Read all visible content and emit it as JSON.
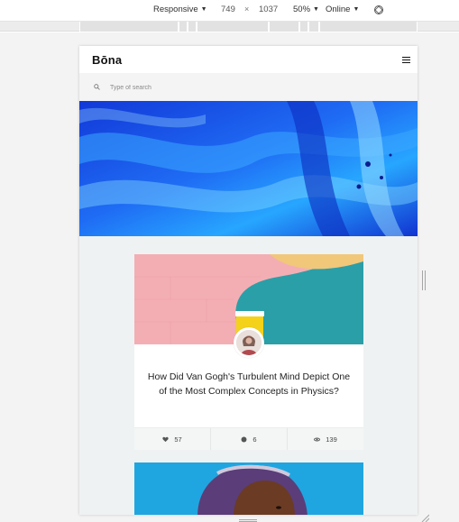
{
  "devtools": {
    "device": "Responsive",
    "width": "749",
    "times": "×",
    "height": "1037",
    "zoom": "50%",
    "network": "Online",
    "rotate_icon": "rotate-icon"
  },
  "site": {
    "logo": "Bōna",
    "menu_icon": "hamburger-menu-icon",
    "search": {
      "placeholder": "Type of search",
      "icon": "search-icon"
    }
  },
  "cards": [
    {
      "title": "How Did Van Gogh's Turbulent Mind Depict One of the Most Complex Concepts in Physics?",
      "likes": "57",
      "comments": "6",
      "views": "139"
    }
  ],
  "colors": {
    "hero_blue": "#1a3cff",
    "card_teal": "#2a9fa8",
    "card_pink": "#f3aeb4",
    "card_yellow": "#f1c77a",
    "card2_sky": "#1fa6e0"
  }
}
